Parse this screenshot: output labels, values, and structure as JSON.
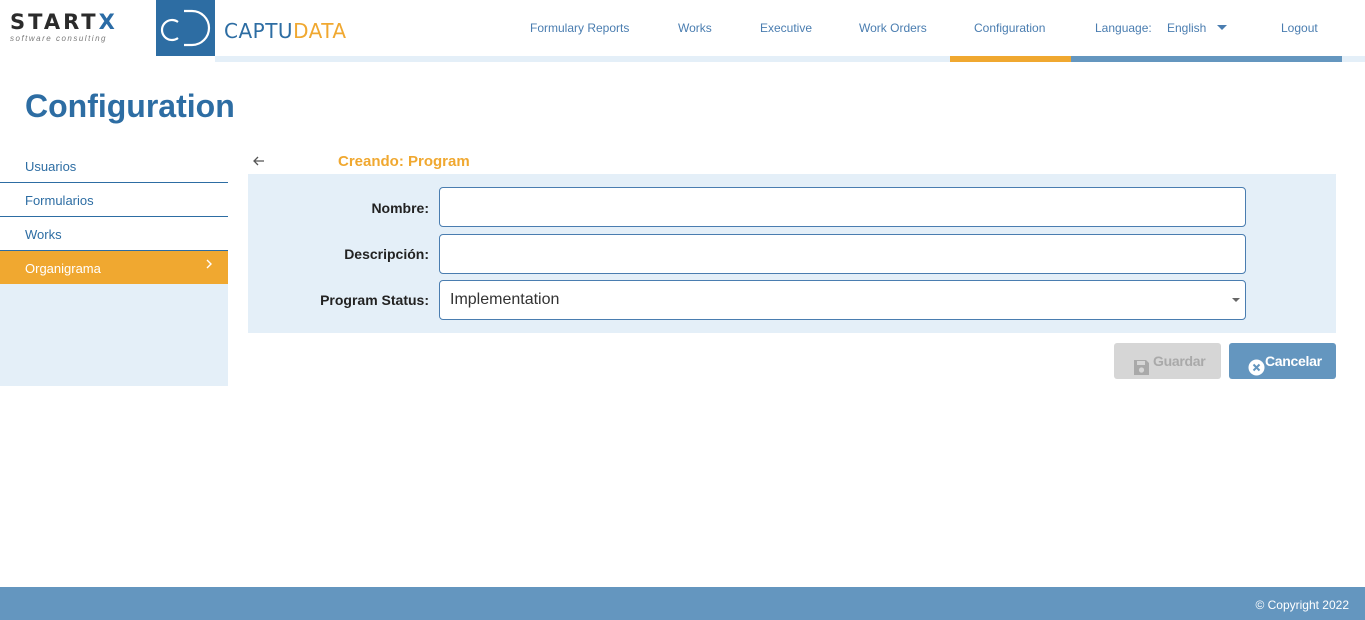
{
  "header": {
    "startx_logo": {
      "word_main": "STARTX",
      "tagline": "software consulting"
    },
    "cd_logo": "cD",
    "brand": {
      "part1": "CAPTU",
      "part2": "DATA"
    },
    "nav": [
      {
        "label": "Formulary Reports"
      },
      {
        "label": "Works"
      },
      {
        "label": "Executive"
      },
      {
        "label": "Work Orders"
      },
      {
        "label": "Configuration",
        "active": true
      }
    ],
    "language_label": "Language:",
    "language_value": "English",
    "logout": "Logout"
  },
  "page_title": "Configuration",
  "sidebar": {
    "items": [
      {
        "label": "Usuarios"
      },
      {
        "label": "Formularios"
      },
      {
        "label": "Works"
      },
      {
        "label": "Organigrama",
        "active": true,
        "icon": "chevron-right-icon"
      }
    ]
  },
  "form": {
    "title": "Creando: Program",
    "back_icon": "arrow-left-icon",
    "fields": {
      "nombre": {
        "label": "Nombre:",
        "value": ""
      },
      "descripcion": {
        "label": "Descripción:",
        "value": ""
      },
      "program_status": {
        "label": "Program Status:",
        "value": "Implementation"
      }
    },
    "buttons": {
      "save": {
        "label": "Guardar",
        "icon": "floppy-disk-icon",
        "disabled": true
      },
      "cancel": {
        "label": "Cancelar",
        "icon": "circle-x-icon"
      }
    }
  },
  "footer": {
    "copyright": "© Copyright 2022"
  },
  "colors": {
    "primary": "#2d6da3",
    "accent": "#f0a830",
    "panel": "#e4eff8",
    "nav_text": "#4a7db0",
    "footer": "#6496bf"
  }
}
